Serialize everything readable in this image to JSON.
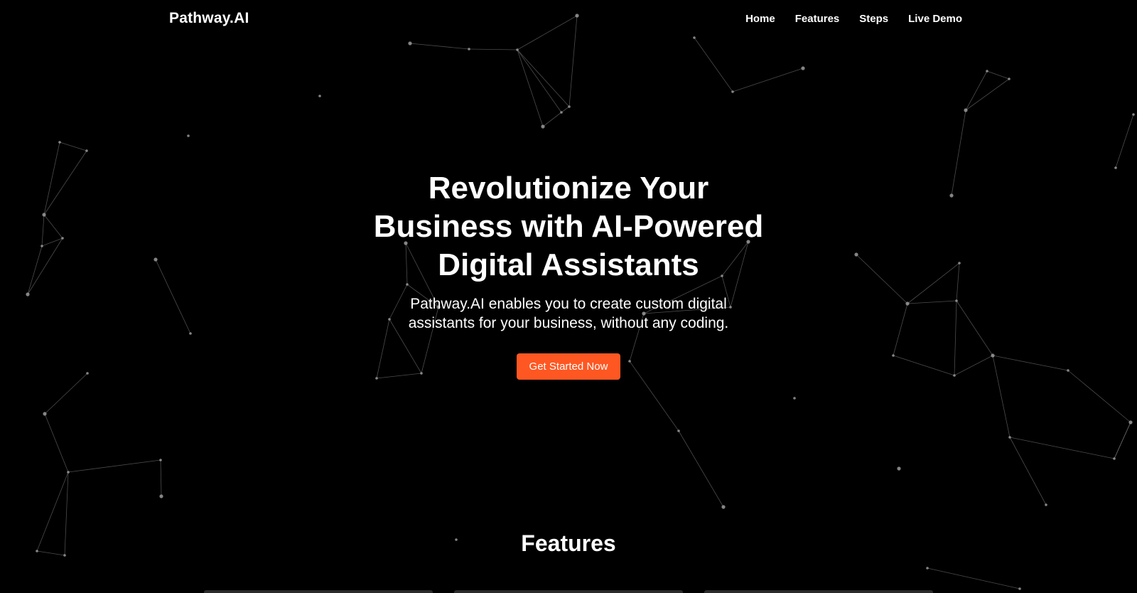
{
  "header": {
    "brand": "Pathway.AI",
    "nav": [
      "Home",
      "Features",
      "Steps",
      "Live Demo"
    ]
  },
  "hero": {
    "title": "Revolutionize Your Business with AI-Powered Digital Assistants",
    "subtitle": "Pathway.AI enables you to create custom digital assistants for your business, without any coding.",
    "cta_label": "Get Started Now"
  },
  "features": {
    "heading": "Features"
  },
  "colors": {
    "background": "#000000",
    "accent": "#ff5722",
    "text": "#ffffff",
    "network_lines": "#8a8a8a"
  }
}
